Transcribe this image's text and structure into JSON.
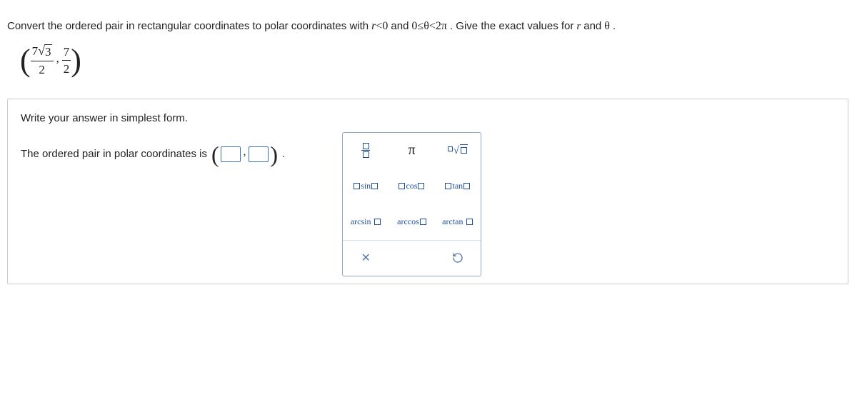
{
  "question": {
    "lead": "Convert the ordered pair in rectangular coordinates to polar coordinates with ",
    "cond1_a": "r",
    "cond1_op": "<",
    "cond1_b": "0",
    "and": " and ",
    "cond2": "0≤θ<2π",
    "tail": ". Give the exact values for ",
    "rvar": "r",
    "and2": " and ",
    "thetavar": "θ",
    "period": "."
  },
  "pair": {
    "x_num_a": "7",
    "x_num_rad": "3",
    "x_den": "2",
    "y_num": "7",
    "y_den": "2"
  },
  "answer": {
    "instruction": "Write your answer in simplest form.",
    "label": "The ordered pair in polar coordinates is",
    "comma": ",",
    "period": "."
  },
  "tools": {
    "pi": "π",
    "sin": "sin",
    "cos": "cos",
    "tan": "tan",
    "arcsin": "arcsin",
    "arccos": "arccos",
    "arctan": "arctan"
  }
}
